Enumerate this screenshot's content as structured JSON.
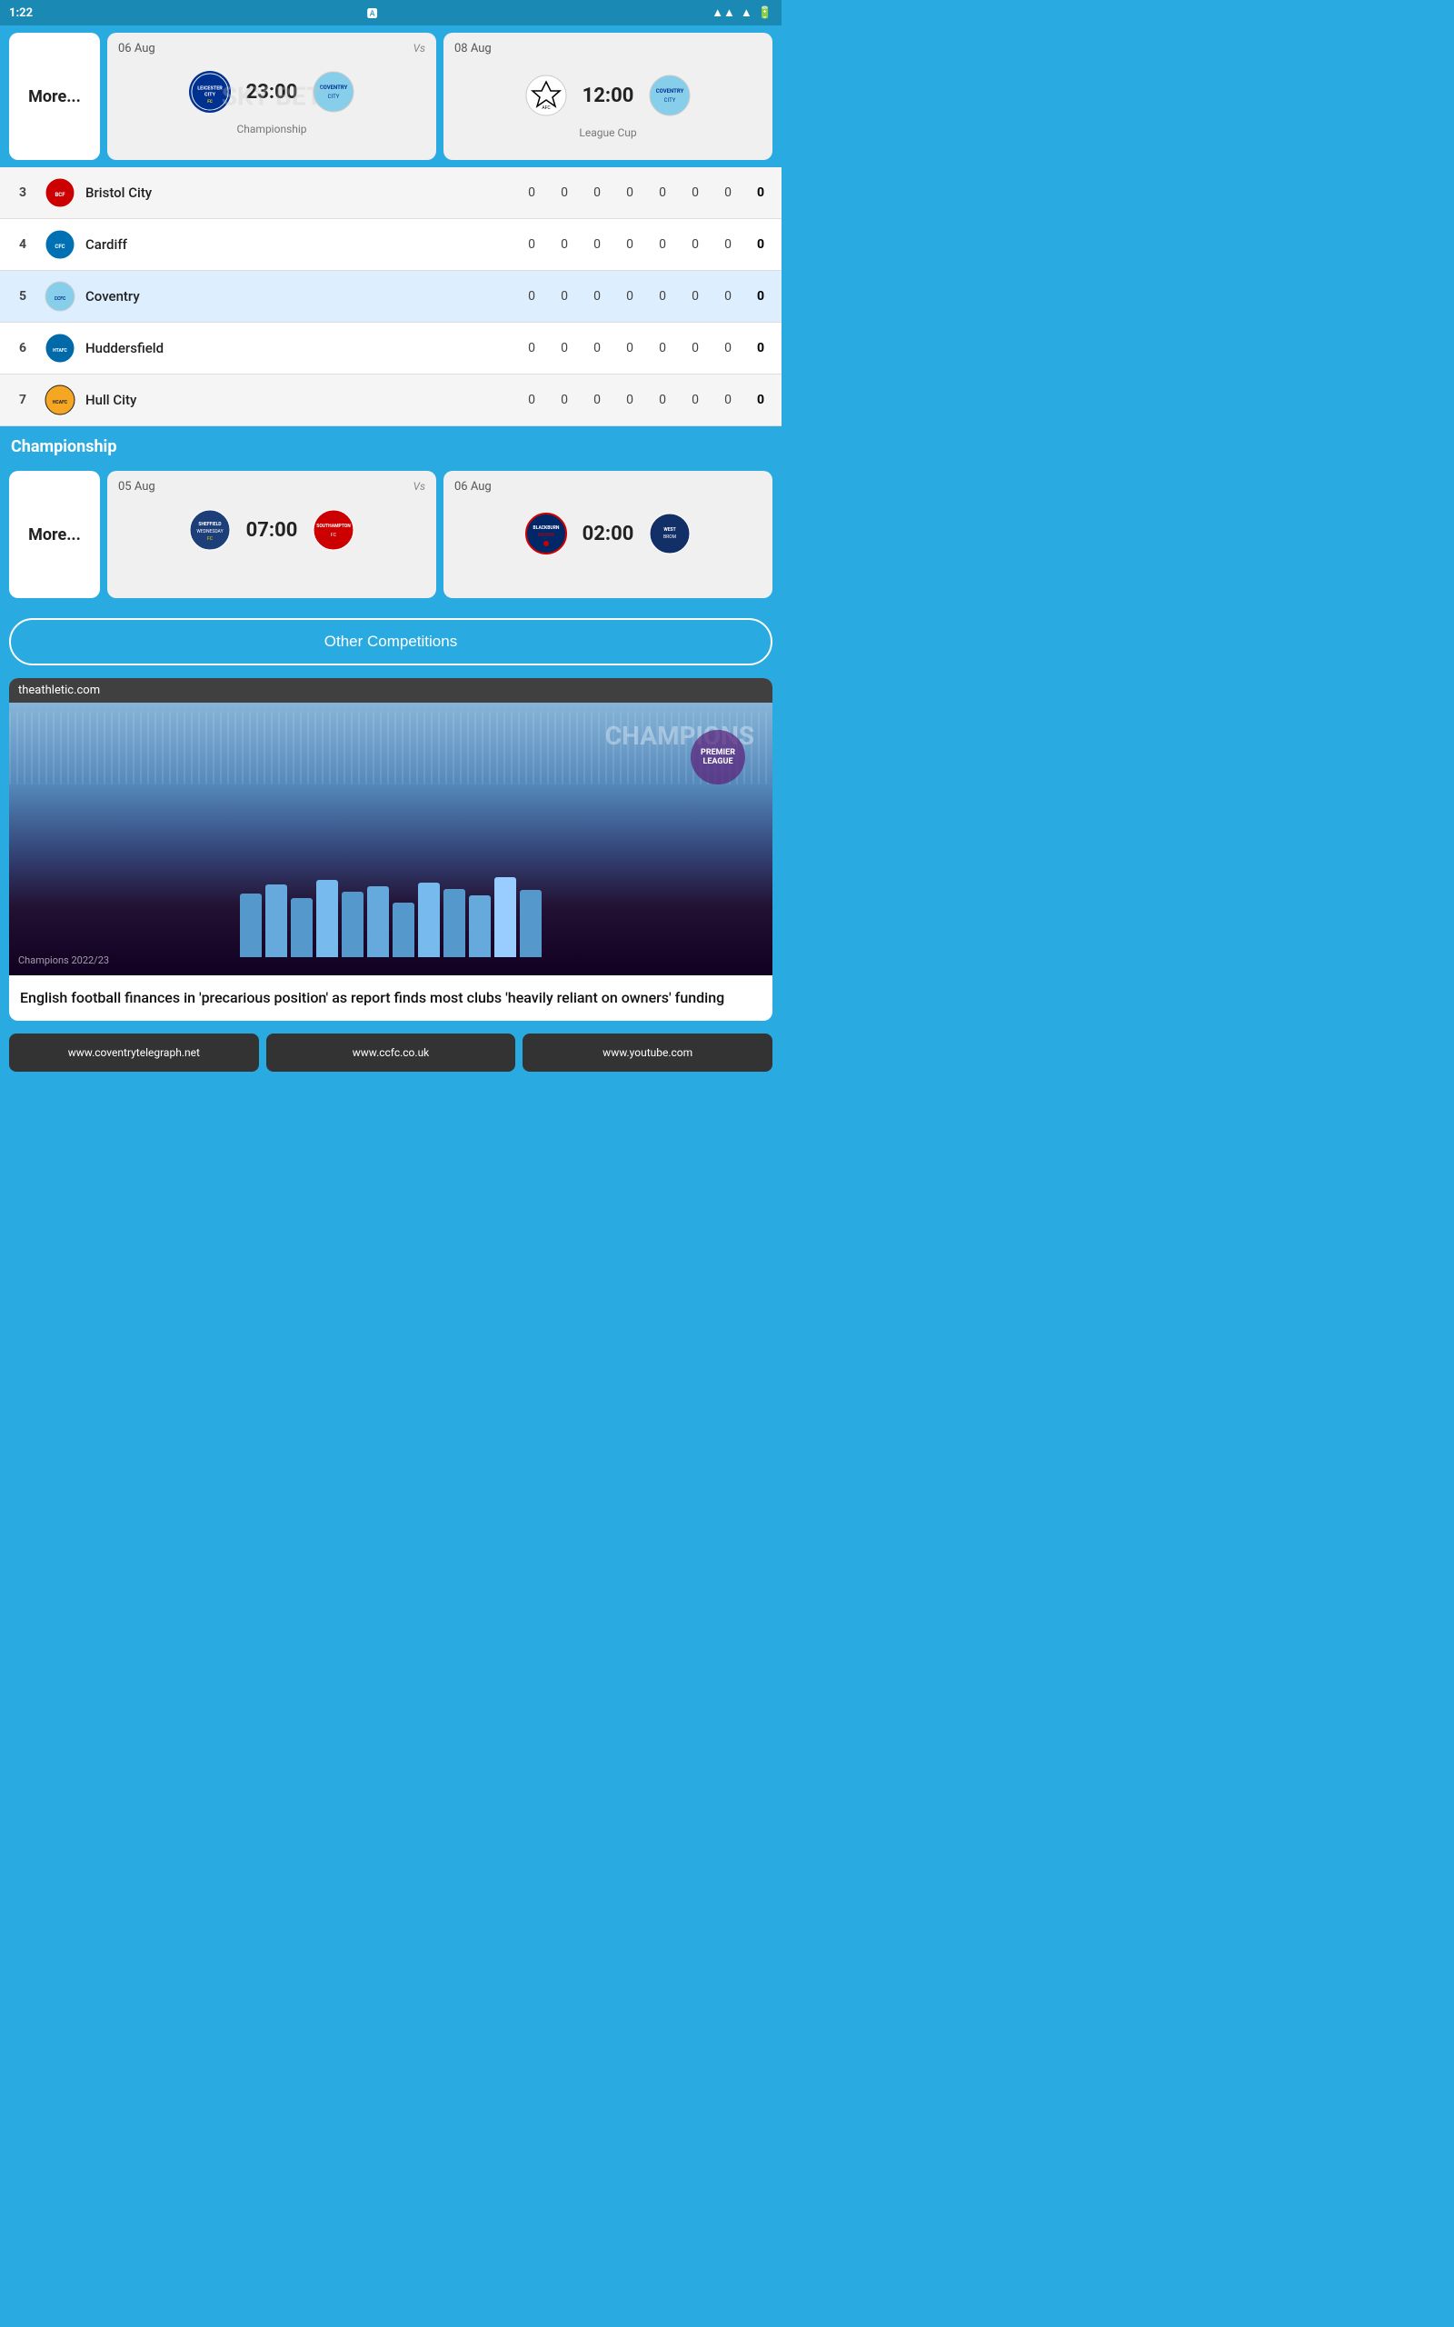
{
  "statusBar": {
    "time": "1:22",
    "icons": [
      "signal",
      "wifi",
      "battery"
    ]
  },
  "leagueCup": {
    "sectionLabel": "League Cup",
    "match1": {
      "date": "06 Aug",
      "vs": "Vs",
      "time": "23:00",
      "competition": "Championship",
      "team1": "Leicester City",
      "team2": "Coventry",
      "team1Color": "#003090",
      "team2Color": "#87CEEB"
    },
    "match2": {
      "date": "08 Aug",
      "vs": "",
      "time": "12:00",
      "competition": "League Cup",
      "team1": "AFC Wimbledon",
      "team2": "Coventry",
      "team1Color": "#1c3f7a",
      "team2Color": "#87CEEB"
    }
  },
  "moreLabel": "More...",
  "tableRows": [
    {
      "pos": "3",
      "name": "Bristol City",
      "logoColor": "#CC0000",
      "stats": [
        "0",
        "0",
        "0",
        "0",
        "0",
        "0",
        "0",
        "0"
      ]
    },
    {
      "pos": "4",
      "name": "Cardiff",
      "logoColor": "#0070B5",
      "stats": [
        "0",
        "0",
        "0",
        "0",
        "0",
        "0",
        "0",
        "0"
      ]
    },
    {
      "pos": "5",
      "name": "Coventry",
      "logoColor": "#87CEEB",
      "stats": [
        "0",
        "0",
        "0",
        "0",
        "0",
        "0",
        "0",
        "0"
      ],
      "highlighted": true
    },
    {
      "pos": "6",
      "name": "Huddersfield",
      "logoColor": "#0069AA",
      "stats": [
        "0",
        "0",
        "0",
        "0",
        "0",
        "0",
        "0",
        "0"
      ]
    },
    {
      "pos": "7",
      "name": "Hull City",
      "logoColor": "#F5A623",
      "stats": [
        "0",
        "0",
        "0",
        "0",
        "0",
        "0",
        "0",
        "0"
      ]
    }
  ],
  "championshipSection": {
    "label": "Championship",
    "match1": {
      "date": "05 Aug",
      "vs": "Vs",
      "time": "07:00",
      "team1": "Sheffield Wednesday",
      "team2": "Southampton",
      "team1Color": "#1c3f7a",
      "team2Color": "#CC0000"
    },
    "match2": {
      "date": "06 Aug",
      "vs": "",
      "time": "02:00",
      "team1": "Blackburn Rovers",
      "team2": "West Brom",
      "team1Color": "#002868",
      "team2Color": "#122F67"
    }
  },
  "otherCompetitionsLabel": "Other Competitions",
  "news": {
    "article1": {
      "source": "theathletic.com",
      "headline": "English football finances in 'precarious position' as report finds most clubs 'heavily reliant on owners' funding",
      "imageCaption": "Champions 2022/23"
    }
  },
  "bottomSources": [
    {
      "url": "www.coventrytelegraph.net"
    },
    {
      "url": "www.ccfc.co.uk"
    },
    {
      "url": "www.youtube.com"
    }
  ]
}
